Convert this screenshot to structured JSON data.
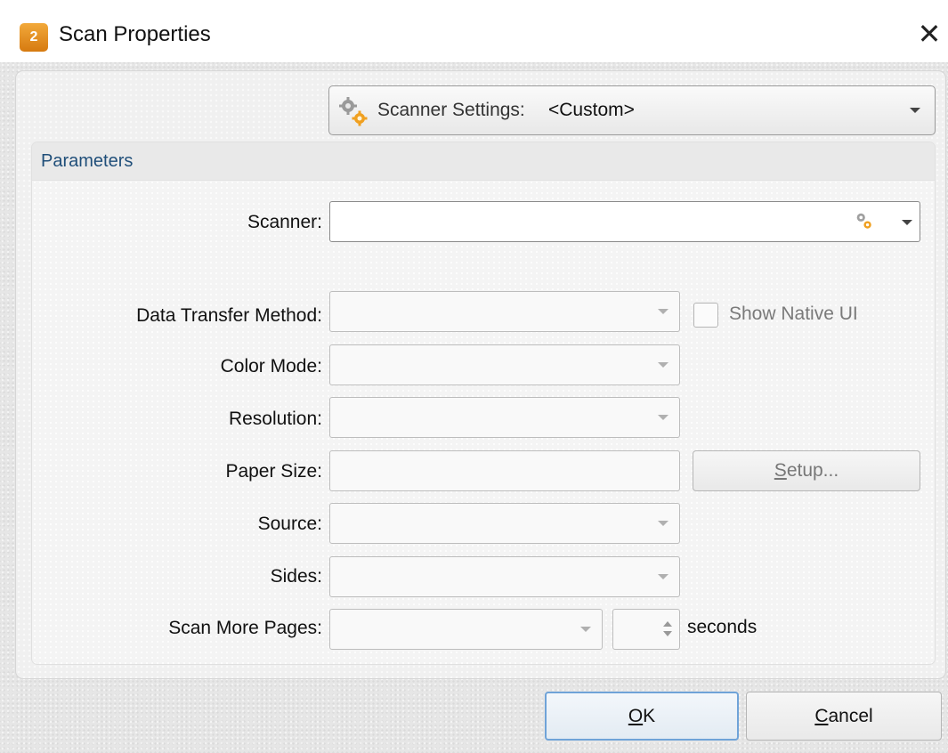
{
  "window": {
    "title": "Scan Properties",
    "app_icon_text": "2"
  },
  "scanner_settings": {
    "label": "Scanner Settings:",
    "value": "<Custom>"
  },
  "parameters": {
    "group_title": "Parameters",
    "scanner_label": "Scanner:",
    "scanner_value": "",
    "data_transfer_label": "Data Transfer Method:",
    "data_transfer_value": "",
    "show_native_ui_label": "Show Native UI",
    "show_native_ui_checked": false,
    "color_mode_label": "Color Mode:",
    "color_mode_value": "",
    "resolution_label": "Resolution:",
    "resolution_value": "",
    "paper_size_label": "Paper Size:",
    "paper_size_value": "",
    "setup_button": {
      "mnemonic": "S",
      "rest": "etup..."
    },
    "source_label": "Source:",
    "source_value": "",
    "sides_label": "Sides:",
    "sides_value": "",
    "scan_more_label": "Scan More Pages:",
    "scan_more_value": "",
    "seconds_value": "",
    "seconds_label": "seconds"
  },
  "footer": {
    "ok_button": {
      "mnemonic": "O",
      "rest": "K"
    },
    "cancel_button": {
      "mnemonic": "C",
      "rest": "ancel"
    }
  },
  "colors": {
    "group_title": "#1f4e79",
    "default_button_border": "#6fa3d8"
  },
  "icons": [
    "app-icon",
    "close-icon",
    "gears-icon",
    "chevron-down-icon",
    "spin-up-icon",
    "spin-down-icon"
  ]
}
